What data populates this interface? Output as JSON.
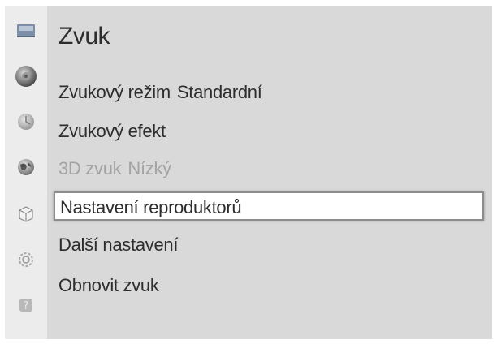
{
  "menu": {
    "title": "Zvuk",
    "items": [
      {
        "label": "Zvukový režim",
        "value": "Standardní",
        "enabled": true,
        "selected": false
      },
      {
        "label": "Zvukový efekt",
        "value": "",
        "enabled": true,
        "selected": false
      },
      {
        "label": "3D zvuk",
        "value": "Nízký",
        "enabled": false,
        "selected": false
      },
      {
        "label": "Nastavení reproduktorů",
        "value": "",
        "enabled": true,
        "selected": true
      },
      {
        "label": "Další nastavení",
        "value": "",
        "enabled": true,
        "selected": false
      },
      {
        "label": "Obnovit zvuk",
        "value": "",
        "enabled": true,
        "selected": false
      }
    ]
  },
  "sidebar": {
    "icons": [
      "picture-icon",
      "sound-icon",
      "broadcast-icon",
      "network-icon",
      "application-icon",
      "system-icon",
      "support-icon"
    ],
    "active": "sound-icon"
  },
  "colors": {
    "panel_background": "#d9d9d9",
    "sidebar_background": "#ececec",
    "text": "#2d2d2d",
    "disabled_text": "#a3a3a3",
    "selection_background": "#ffffff",
    "selection_border": "#8c8c8c"
  }
}
